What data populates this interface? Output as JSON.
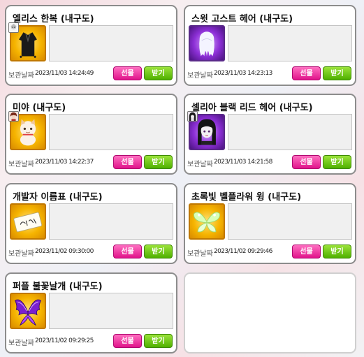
{
  "date_label": "보관날짜",
  "buttons": {
    "gift": "선물",
    "receive": "받기"
  },
  "items": [
    {
      "title": "엘리스 한복 (내구도)",
      "date": "2023/11/03 14:24:49",
      "icon": "hanbok-icon",
      "has_avatar": true
    },
    {
      "title": "스윗 고스트 헤어 (내구도)",
      "date": "2023/11/03 14:23:13",
      "icon": "ghost-hair-icon",
      "has_avatar": false
    },
    {
      "title": "미야 (내구도)",
      "date": "2023/11/03 14:22:37",
      "icon": "cat-plush-icon",
      "has_avatar": true
    },
    {
      "title": "셀리아 블랙 리드 헤어 (내구도)",
      "date": "2023/11/03 14:21:58",
      "icon": "black-hair-icon",
      "has_avatar": true
    },
    {
      "title": "개발자 이름표 (내구도)",
      "date": "2023/11/02 09:30:00",
      "icon": "name-tag-icon",
      "has_avatar": false
    },
    {
      "title": "초록빛 벨플라워 윙 (내구도)",
      "date": "2023/11/02 09:29:46",
      "icon": "bellflower-wing-icon",
      "has_avatar": false
    },
    {
      "title": "퍼플 불꽃날개 (내구도)",
      "date": "2023/11/02 09:29:25",
      "icon": "purple-flame-wing-icon",
      "has_avatar": false
    }
  ],
  "colors": {
    "gift_button": "#e0148a",
    "receive_button": "#4fb000",
    "card_border": "#8c8c8c"
  }
}
